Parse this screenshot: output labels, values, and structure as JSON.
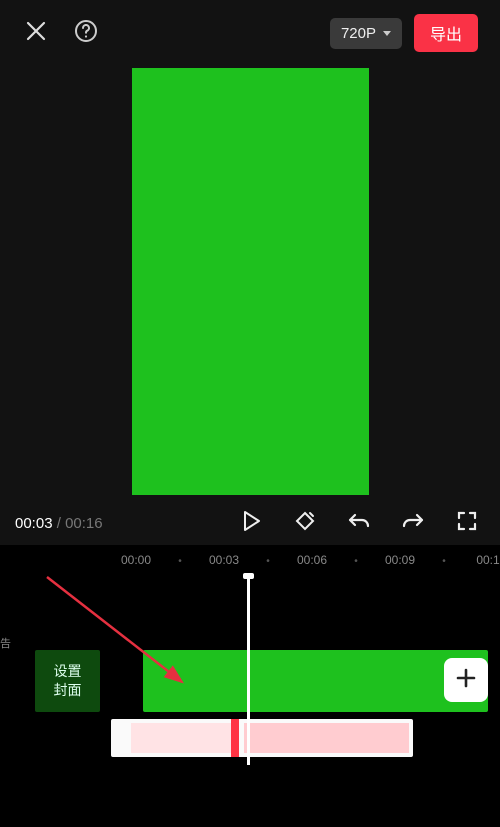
{
  "topbar": {
    "quality_label": "720P",
    "export_label": "导出"
  },
  "playback": {
    "current_time": "00:03",
    "total_time": "00:16"
  },
  "ruler": {
    "ticks": [
      "00:00",
      "00:03",
      "00:06",
      "00:09",
      "00:1"
    ]
  },
  "timeline": {
    "cover_button_label": "设置\n封面"
  },
  "side_label": "告",
  "colors": {
    "green": "#1ec11e",
    "export_red": "#fa3246"
  }
}
